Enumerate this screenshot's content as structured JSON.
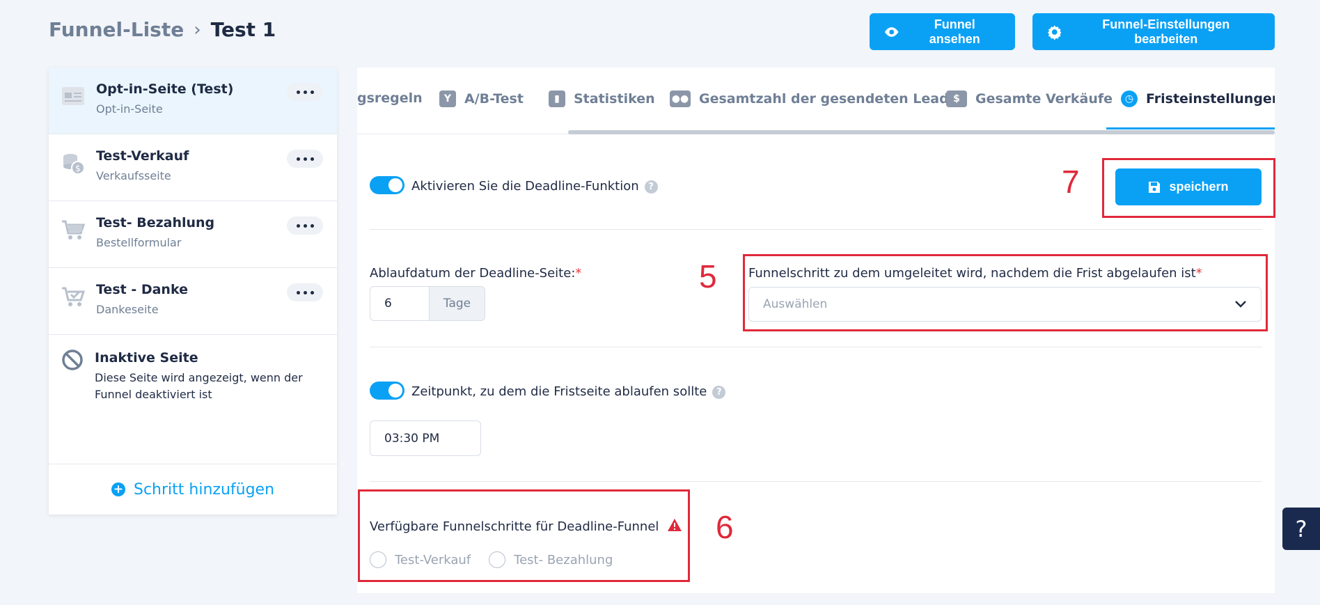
{
  "breadcrumb": {
    "parent": "Funnel-Liste",
    "separator": "›",
    "current": "Test 1"
  },
  "header": {
    "view_funnel": "Funnel ansehen",
    "edit_settings": "Funnel-Einstellungen bearbeiten"
  },
  "sidebar": {
    "steps": [
      {
        "title": "Opt-in-Seite (Test)",
        "subtitle": "Opt-in-Seite",
        "icon": "page-icon"
      },
      {
        "title": "Test-Verkauf",
        "subtitle": "Verkaufsseite",
        "icon": "coins-icon"
      },
      {
        "title": "Test- Bezahlung",
        "subtitle": "Bestellformular",
        "icon": "cart-icon"
      },
      {
        "title": "Test - Danke",
        "subtitle": "Dankeseite",
        "icon": "cart-check-icon"
      }
    ],
    "inactive": {
      "title": "Inaktive Seite",
      "description": "Diese Seite wird angezeigt, wenn der Funnel deaktiviert ist"
    },
    "add_step": "Schritt hinzufügen"
  },
  "tabs": [
    {
      "label": "gsregeln",
      "icon": ""
    },
    {
      "label": "A/B-Test",
      "icon": "split-icon"
    },
    {
      "label": "Statistiken",
      "icon": "bar-chart-icon"
    },
    {
      "label": "Gesamtzahl der gesendeten Leads",
      "icon": "users-icon"
    },
    {
      "label": "Gesamte Verkäufe",
      "icon": "dollar-icon"
    },
    {
      "label": "Fristeinstellungen",
      "icon": "clock-icon"
    }
  ],
  "tab_active": "Fristeinstellungen",
  "deadline": {
    "enable_label": "Aktivieren Sie die Deadline-Funktion",
    "save_label": "speichern",
    "expiry_label": "Ablaufdatum der Deadline-Seite:",
    "required_mark": "*",
    "expiry_value": "6",
    "expiry_unit": "Tage",
    "redirect_label": "Funnelschritt zu dem umgeleitet wird, nachdem die Frist abgelaufen ist",
    "redirect_placeholder": "Auswählen",
    "time_toggle_label": "Zeitpunkt, zu dem die Fristseite ablaufen sollte",
    "time_value": "03:30 PM",
    "available_label": "Verfügbare Funnelschritte für Deadline-Funnel",
    "available_options": [
      "Test-Verkauf",
      "Test- Bezahlung"
    ],
    "help_mark": "?"
  },
  "annotations": [
    "7",
    "5",
    "6"
  ],
  "help_fab": "?",
  "colors": {
    "accent": "#0aa1f5",
    "annotation": "#e0293a",
    "fab": "#1a2a4f"
  }
}
